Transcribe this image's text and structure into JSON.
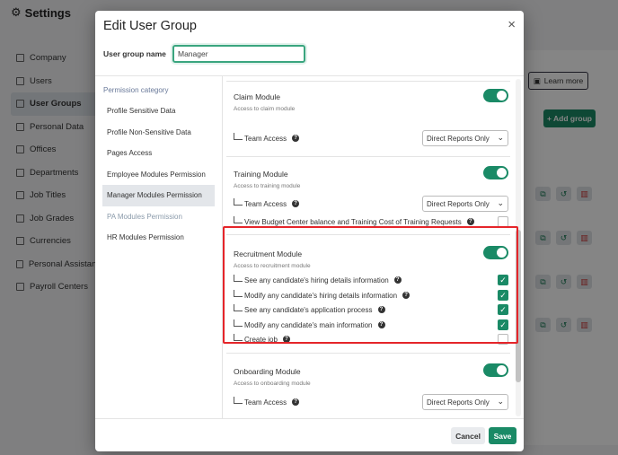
{
  "app": {
    "title": "Settings",
    "sidebar": [
      {
        "label": "Company",
        "icon": "building-icon"
      },
      {
        "label": "Users",
        "icon": "users-icon"
      },
      {
        "label": "User Groups",
        "icon": "user-groups-icon",
        "active": true
      },
      {
        "label": "Personal Data",
        "icon": "id-card-icon"
      },
      {
        "label": "Offices",
        "icon": "office-icon"
      },
      {
        "label": "Departments",
        "icon": "departments-icon"
      },
      {
        "label": "Job Titles",
        "icon": "briefcase-icon"
      },
      {
        "label": "Job Grades",
        "icon": "grade-icon"
      },
      {
        "label": "Currencies",
        "icon": "exchange-icon"
      },
      {
        "label": "Personal Assistant",
        "icon": "assistant-icon"
      },
      {
        "label": "Payroll Centers",
        "icon": "payroll-icon"
      }
    ],
    "learn_more": "Learn more",
    "add_group": "+ Add group"
  },
  "modal": {
    "title": "Edit User Group",
    "close": "×",
    "group_name_label": "User group name",
    "group_name_value": "Manager",
    "category_label": "Permission category",
    "categories": [
      {
        "label": "Profile Sensitive Data"
      },
      {
        "label": "Profile Non-Sensitive Data"
      },
      {
        "label": "Pages Access"
      },
      {
        "label": "Employee Modules Permission"
      },
      {
        "label": "Manager Modules Permission",
        "active": true
      },
      {
        "label": "PA Modules Permission",
        "disabled": true
      },
      {
        "label": "HR Modules Permission"
      }
    ],
    "modules": {
      "claim": {
        "title": "Claim Module",
        "subtitle": "Access to claim module",
        "enabled": true,
        "team_access_label": "Team Access",
        "team_access_value": "Direct Reports Only"
      },
      "training": {
        "title": "Training Module",
        "subtitle": "Access to training module",
        "enabled": true,
        "team_access_label": "Team Access",
        "team_access_value": "Direct Reports Only",
        "budget_label": "View Budget Center balance and Training Cost of Training Requests",
        "budget_checked": false
      },
      "recruitment": {
        "title": "Recruitment Module",
        "subtitle": "Access to recruitment module",
        "enabled": true,
        "items": [
          {
            "label": "See any candidate's hiring details information",
            "checked": true
          },
          {
            "label": "Modify any candidate's hiring details information",
            "checked": true
          },
          {
            "label": "See any candidate's application process",
            "checked": true
          },
          {
            "label": "Modify any candidate's main information",
            "checked": true
          },
          {
            "label": "Create job",
            "checked": false
          }
        ]
      },
      "onboarding": {
        "title": "Onboarding Module",
        "subtitle": "Access to onboarding module",
        "enabled": true,
        "team_access_label": "Team Access",
        "team_access_value": "Direct Reports Only"
      }
    },
    "cancel_label": "Cancel",
    "save_label": "Save"
  },
  "colors": {
    "accent": "#1a8a66",
    "highlight": "#e5252a",
    "input_focus": "#3aa57f"
  }
}
